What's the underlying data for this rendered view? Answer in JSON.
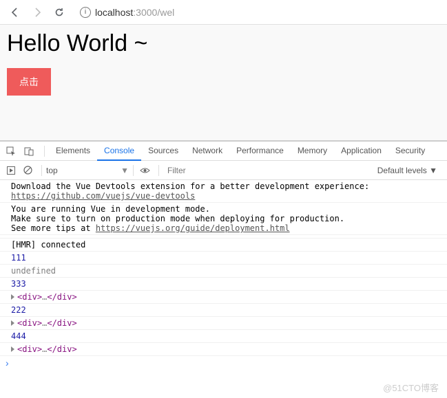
{
  "nav": {
    "url_host": "localhost",
    "url_port": ":3000",
    "url_path": "/wel"
  },
  "page": {
    "heading": "Hello World ~",
    "button_label": "点击"
  },
  "devtools": {
    "tabs": [
      "Elements",
      "Console",
      "Sources",
      "Network",
      "Performance",
      "Memory",
      "Application",
      "Security"
    ],
    "active_tab": 1,
    "context": "top",
    "filter_placeholder": "Filter",
    "levels": "Default levels ▼",
    "lines": [
      {
        "type": "msg",
        "text": "Download the Vue Devtools extension for a better development experience:"
      },
      {
        "type": "link",
        "text": "https://github.com/vuejs/vue-devtools"
      },
      {
        "type": "msg",
        "text": "You are running Vue in development mode."
      },
      {
        "type": "msg",
        "text": "Make sure to turn on production mode when deploying for production."
      },
      {
        "type": "linkpre",
        "pre": "See more tips at ",
        "text": "https://vuejs.org/guide/deployment.html"
      },
      {
        "type": "msg",
        "text": "[HMR] connected"
      },
      {
        "type": "num",
        "text": "111"
      },
      {
        "type": "undef",
        "text": "undefined"
      },
      {
        "type": "num",
        "text": "333"
      },
      {
        "type": "dom",
        "open": "<div>",
        "mid": "…",
        "close": "</div>"
      },
      {
        "type": "num",
        "text": "222"
      },
      {
        "type": "dom",
        "open": "<div>",
        "mid": "…",
        "close": "</div>"
      },
      {
        "type": "num",
        "text": "444"
      },
      {
        "type": "dom",
        "open": "<div>",
        "mid": "…",
        "close": "</div>"
      }
    ]
  },
  "watermark": "@51CTO博客"
}
